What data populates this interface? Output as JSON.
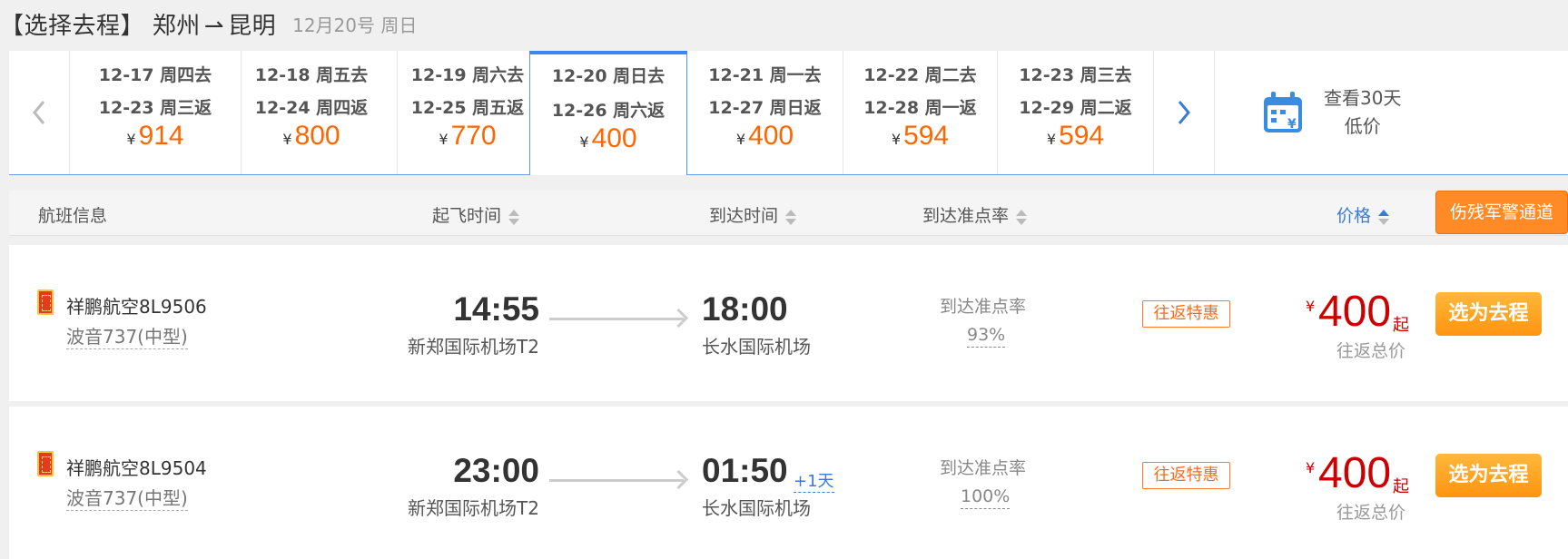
{
  "header": {
    "title_prefix": "【选择去程】",
    "from": "郑州",
    "arrow": "⇀",
    "to": "昆明",
    "date": "12月20号 周日"
  },
  "date_strip": {
    "days": [
      {
        "go": "12-17 周四去",
        "back": "12-23 周三返",
        "yen": "¥",
        "price": "914"
      },
      {
        "go": "12-18 周五去",
        "back": "12-24 周四返",
        "yen": "¥",
        "price": "800"
      },
      {
        "go": "12-19 周六去",
        "back": "12-25 周五返",
        "yen": "¥",
        "price": "770"
      },
      {
        "go": "12-20 周日去",
        "back": "12-26 周六返",
        "yen": "¥",
        "price": "400"
      },
      {
        "go": "12-21 周一去",
        "back": "12-27 周日返",
        "yen": "¥",
        "price": "400"
      },
      {
        "go": "12-22 周二去",
        "back": "12-28 周一返",
        "yen": "¥",
        "price": "594"
      },
      {
        "go": "12-23 周三去",
        "back": "12-29 周二返",
        "yen": "¥",
        "price": "594"
      }
    ],
    "selected_index": 3,
    "calendar_line1": "查看30天",
    "calendar_line2": "低价",
    "accent_color": "#ff6600",
    "active_border_color": "#3b86f0"
  },
  "columns": {
    "flight_info": "航班信息",
    "depart_time": "起飞时间",
    "arrive_time": "到达时间",
    "on_time_rate": "到达准点率",
    "price": "价格",
    "special_channel": "伤残军警通道"
  },
  "flights": [
    {
      "airline": "祥鹏航空8L9506",
      "aircraft": "波音737(中型)",
      "depart_time": "14:55",
      "depart_airport": "新郑国际机场T2",
      "arrive_time": "18:00",
      "plus_day": "",
      "arrive_airport": "长水国际机场",
      "on_time_label": "到达准点率",
      "on_time_value": "93%",
      "deal_tag": "往返特惠",
      "yen": "¥",
      "price": "400",
      "price_suffix": "起",
      "price_note": "往返总价",
      "select_label": "选为去程"
    },
    {
      "airline": "祥鹏航空8L9504",
      "aircraft": "波音737(中型)",
      "depart_time": "23:00",
      "depart_airport": "新郑国际机场T2",
      "arrive_time": "01:50",
      "plus_day": "+1天",
      "arrive_airport": "长水国际机场",
      "on_time_label": "到达准点率",
      "on_time_value": "100%",
      "deal_tag": "往返特惠",
      "yen": "¥",
      "price": "400",
      "price_suffix": "起",
      "price_note": "往返总价",
      "select_label": "选为去程"
    }
  ],
  "icons": {
    "prev": "chevron-left-icon",
    "next": "chevron-right-icon",
    "calendar": "calendar-yen-icon",
    "sort": "sort-icon",
    "airline_logo": "airline-logo-icon"
  }
}
